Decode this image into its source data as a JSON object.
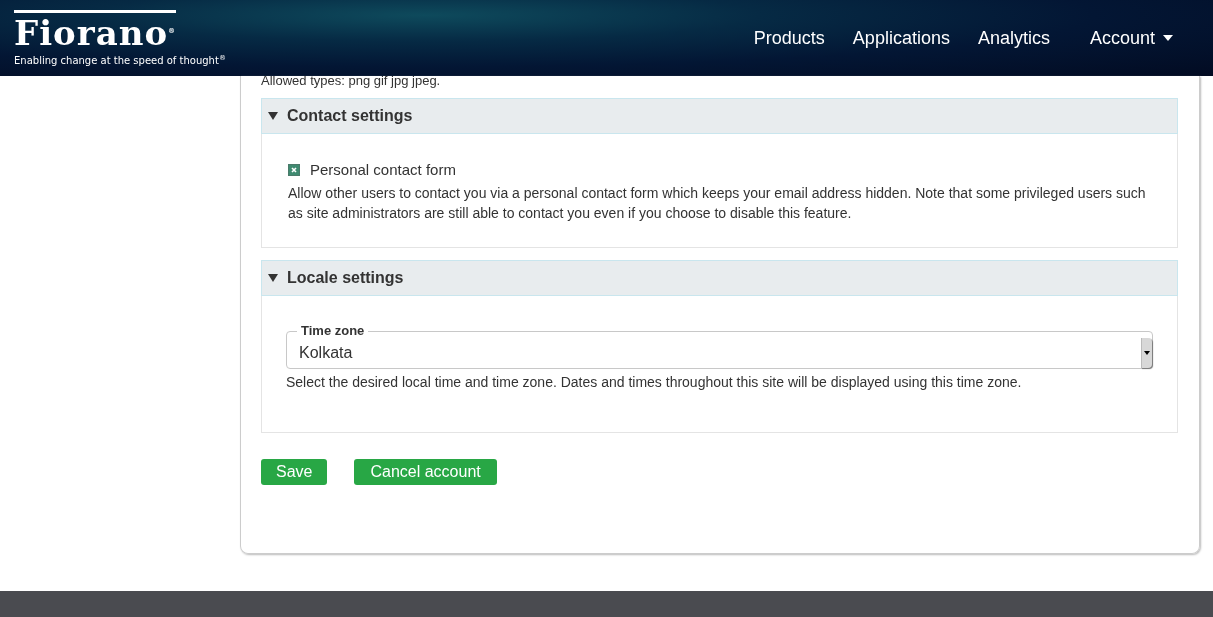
{
  "header": {
    "logo": "Fiorano$^{®}$",
    "tagline": "Enabling change at the speed of thought$^{®}$",
    "nav": [
      {
        "label": "Products",
        "kind": "link"
      },
      {
        "label": "Applications",
        "kind": "link"
      },
      {
        "label": "Analytics",
        "kind": "link"
      },
      {
        "label": "Account",
        "kind": "dropdown"
      }
    ]
  },
  "allowed_types": "Allowed types: png gif jpg jpeg.",
  "sections": [
    {
      "title": "Contact settings",
      "expanded": true,
      "kind": "checkbox",
      "checkbox": {
        "label": "Personal contact form",
        "checked": true
      },
      "description": "Allow other users to contact you via a personal contact form which keeps your email address hidden. Note that some privileged users such as site administrators are still able to contact you even if you choose to disable this feature."
    },
    {
      "title": "Locale settings",
      "expanded": true,
      "kind": "select",
      "field": {
        "label": "Time zone",
        "value": "Kolkata"
      },
      "description": "Select the desired local time and time zone. Dates and times throughout this site will be displayed using this time zone."
    }
  ],
  "buttons": [
    "Save",
    "Cancel account"
  ]
}
